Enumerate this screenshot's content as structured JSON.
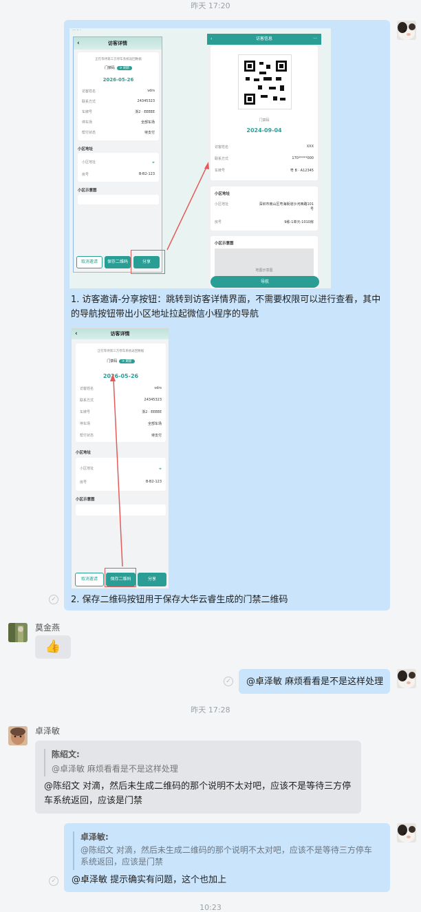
{
  "timestamps": [
    "昨天 17:20",
    "昨天 17:28",
    "10:23"
  ],
  "msg1": {
    "text1": "1. 访客邀请-分享按钮：跳转到访客详情界面，不需要权限可以进行查看，其中的导航按钮带出小区地址拉起微信小程序的导航",
    "text2": "2. 保存二维码按钮用于保存大华云睿生成的门禁二维码"
  },
  "visitor_detail": {
    "title": "访客详情",
    "notice": "正在等待第三方停车系统返回数据",
    "door_code": "门禁码",
    "refresh": "刷新",
    "date": "2026-05-26",
    "rows": [
      {
        "label": "访客姓名",
        "value": "vdrs"
      },
      {
        "label": "联系方式",
        "value": "24345323"
      },
      {
        "label": "车牌号",
        "value": "浙2 · EEEEE"
      },
      {
        "label": "停车场",
        "value": "全部车场"
      },
      {
        "label": "帮付状态",
        "value": "待支付"
      }
    ],
    "addr_title": "小区地址",
    "addr_rows": [
      {
        "label": "小区地址",
        "value": ""
      },
      {
        "label": "房号",
        "value": "B-B2-123"
      }
    ],
    "map_title": "小区示意图",
    "btn_cancel": "取消邀请",
    "btn_save": "保存二维码",
    "btn_share": "分享"
  },
  "visitor_info": {
    "title": "访客信息",
    "more": "···",
    "door_code": "门禁码",
    "date": "2024-09-04",
    "rows": [
      {
        "label": "访客姓名",
        "value": "XXX"
      },
      {
        "label": "联系方式",
        "value": "170*****000"
      },
      {
        "label": "车牌号",
        "value": "粤 B · A12345"
      }
    ],
    "addr_title": "小区地址",
    "addr_rows": [
      {
        "label": "小区地址",
        "value": "深圳市南山区粤海街道沙河西路101号"
      },
      {
        "label": "房号",
        "value": "9栋-1单元-1010房"
      }
    ],
    "map_title": "小区示意图",
    "map_placeholder": "地图示意图",
    "nav_btn": "导航"
  },
  "user_mojinyan": {
    "name": "莫金燕",
    "emoji": "👍"
  },
  "msg_me2": "@卓泽敏 麻烦看看是不是这样处理",
  "user_zhuozemin": {
    "name": "卓泽敏",
    "quote_author": "陈绍文:",
    "quote_text": "@卓泽敏  麻烦看看是不是这样处理",
    "reply": "@陈绍文  对滴，然后未生成二维码的那个说明不太对吧，应该不是等待三方停车系统返回，应该是门禁"
  },
  "msg_me3": {
    "quote_author": "卓泽敏:",
    "quote_text": "@陈绍文  对滴，然后未生成二维码的那个说明不太对吧，应该不是等待三方停车系统返回，应该是门禁",
    "reply": "@卓泽敏 提示确实有问题，这个也加上"
  },
  "colors": {
    "accent": "#2a9d95",
    "bubble_me": "#c9e4fb",
    "bubble_other": "#e3e5e8",
    "arrow": "#e45a5a"
  }
}
